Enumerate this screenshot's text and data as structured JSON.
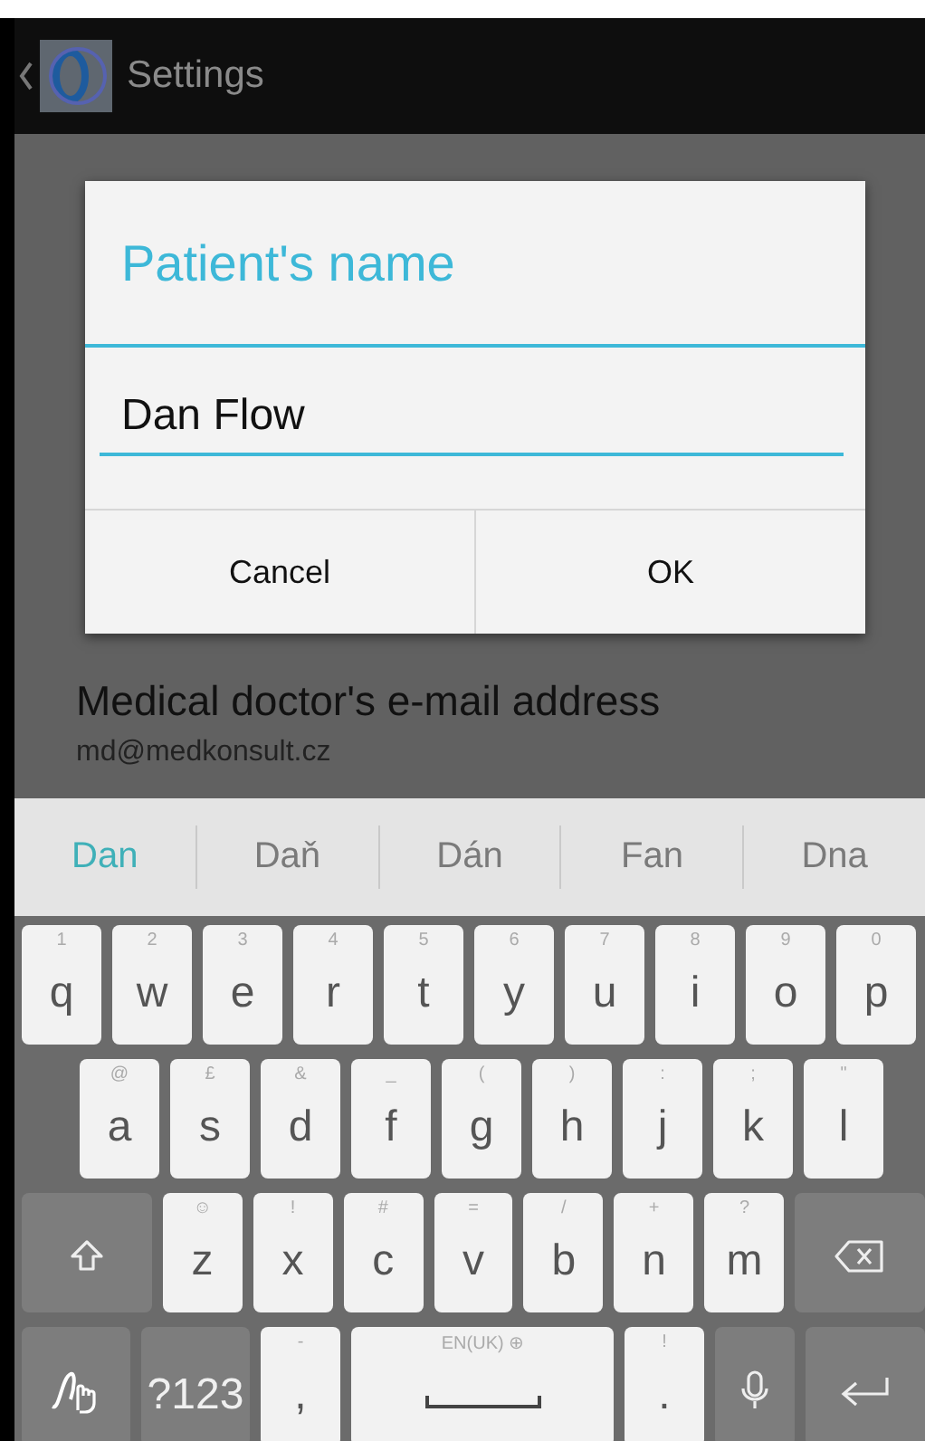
{
  "action_bar": {
    "title": "Settings"
  },
  "settings": [
    {
      "title": "Medical doctor's e-mail address",
      "value": "md@medkonsult.cz"
    }
  ],
  "dialog": {
    "title": "Patient's name",
    "value": "Dan Flow",
    "buttons": [
      "Cancel",
      "OK"
    ]
  },
  "suggestions": [
    {
      "label": "Dan",
      "selected": true
    },
    {
      "label": "Daň",
      "selected": false
    },
    {
      "label": "Dán",
      "selected": false
    },
    {
      "label": "Fan",
      "selected": false
    },
    {
      "label": "Dna",
      "selected": false
    }
  ],
  "keyboard": {
    "rows": [
      {
        "keys": [
          {
            "kind": "letter",
            "label": "q",
            "hint": "1"
          },
          {
            "kind": "letter",
            "label": "w",
            "hint": "2"
          },
          {
            "kind": "letter",
            "label": "e",
            "hint": "3"
          },
          {
            "kind": "letter",
            "label": "r",
            "hint": "4"
          },
          {
            "kind": "letter",
            "label": "t",
            "hint": "5"
          },
          {
            "kind": "letter",
            "label": "y",
            "hint": "6"
          },
          {
            "kind": "letter",
            "label": "u",
            "hint": "7"
          },
          {
            "kind": "letter",
            "label": "i",
            "hint": "8"
          },
          {
            "kind": "letter",
            "label": "o",
            "hint": "9"
          },
          {
            "kind": "letter",
            "label": "p",
            "hint": "0"
          }
        ]
      },
      {
        "keys": [
          {
            "kind": "letter",
            "label": "a",
            "hint": "@"
          },
          {
            "kind": "letter",
            "label": "s",
            "hint": "£"
          },
          {
            "kind": "letter",
            "label": "d",
            "hint": "&"
          },
          {
            "kind": "letter",
            "label": "f",
            "hint": "_"
          },
          {
            "kind": "letter",
            "label": "g",
            "hint": "("
          },
          {
            "kind": "letter",
            "label": "h",
            "hint": ")"
          },
          {
            "kind": "letter",
            "label": "j",
            "hint": ":"
          },
          {
            "kind": "letter",
            "label": "k",
            "hint": ";"
          },
          {
            "kind": "letter",
            "label": "l",
            "hint": "\""
          }
        ]
      },
      {
        "keys": [
          {
            "kind": "shift"
          },
          {
            "kind": "letter",
            "label": "z",
            "hint": "☺"
          },
          {
            "kind": "letter",
            "label": "x",
            "hint": "!"
          },
          {
            "kind": "letter",
            "label": "c",
            "hint": "#"
          },
          {
            "kind": "letter",
            "label": "v",
            "hint": "="
          },
          {
            "kind": "letter",
            "label": "b",
            "hint": "/"
          },
          {
            "kind": "letter",
            "label": "n",
            "hint": "+"
          },
          {
            "kind": "letter",
            "label": "m",
            "hint": "?"
          },
          {
            "kind": "backspace"
          }
        ]
      },
      {
        "keys": [
          {
            "kind": "swipe"
          },
          {
            "kind": "symbols",
            "label": "?123"
          },
          {
            "kind": "letter",
            "label": ",",
            "hint": "-"
          },
          {
            "kind": "space",
            "hint": "EN(UK) ⊕"
          },
          {
            "kind": "letter",
            "label": ".",
            "hint": "!"
          },
          {
            "kind": "mic"
          },
          {
            "kind": "enter"
          }
        ]
      }
    ]
  }
}
